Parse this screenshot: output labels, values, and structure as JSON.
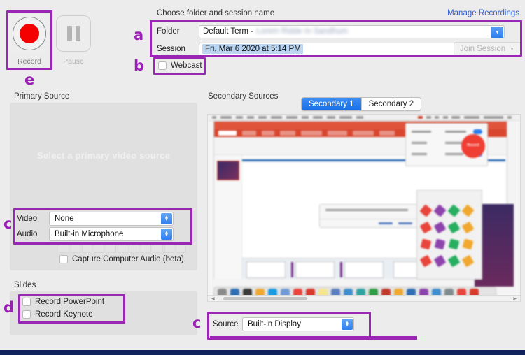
{
  "transport": {
    "record_label": "Record",
    "pause_label": "Pause",
    "record_icon": "record-dot-icon",
    "pause_icon": "pause-bars-icon"
  },
  "session_form": {
    "heading": "Choose folder and session name",
    "manage_link": "Manage Recordings",
    "folder_label": "Folder",
    "folder_value": "Default Term -",
    "folder_value_redacted": "Lorem Ridde In Sandhum",
    "session_label": "Session",
    "session_value": "Fri, Mar 6 2020 at 5:14 PM",
    "join_session_label": "Join Session",
    "webcast_label": "Webcast",
    "webcast_checked": false
  },
  "primary": {
    "title": "Primary Source",
    "placeholder": "Select a primary video source",
    "video_label": "Video",
    "video_value": "None",
    "audio_label": "Audio",
    "audio_value": "Built-in Microphone",
    "capture_audio_label": "Capture Computer Audio (beta)",
    "capture_audio_checked": false,
    "meter_segments": 11
  },
  "slides": {
    "title": "Slides",
    "items": [
      {
        "label": "Record PowerPoint",
        "checked": false
      },
      {
        "label": "Record Keynote",
        "checked": false
      }
    ]
  },
  "secondary": {
    "title": "Secondary Sources",
    "tabs": [
      {
        "label": "Secondary 1",
        "active": true
      },
      {
        "label": "Secondary 2",
        "active": false
      }
    ],
    "source_label": "Source",
    "source_value": "Built-in Display"
  },
  "annotations": [
    {
      "letter": "a",
      "target": "folder-and-session-fields"
    },
    {
      "letter": "b",
      "target": "webcast-checkbox"
    },
    {
      "letter": "c",
      "target": "video-audio-selects"
    },
    {
      "letter": "c",
      "target": "secondary-source-select"
    },
    {
      "letter": "d",
      "target": "slides-checkboxes"
    },
    {
      "letter": "e",
      "target": "record-button"
    }
  ],
  "colors": {
    "annotation_purple": "#9b26b6",
    "record_red": "#f40000",
    "link_blue": "#2c5fd6",
    "tab_active_blue": "#176ee4",
    "selection_blue": "#b9d6f5",
    "window_bg": "#ececec",
    "panel_bg": "#e0e0e0",
    "bottom_strip_navy": "#11235c"
  }
}
